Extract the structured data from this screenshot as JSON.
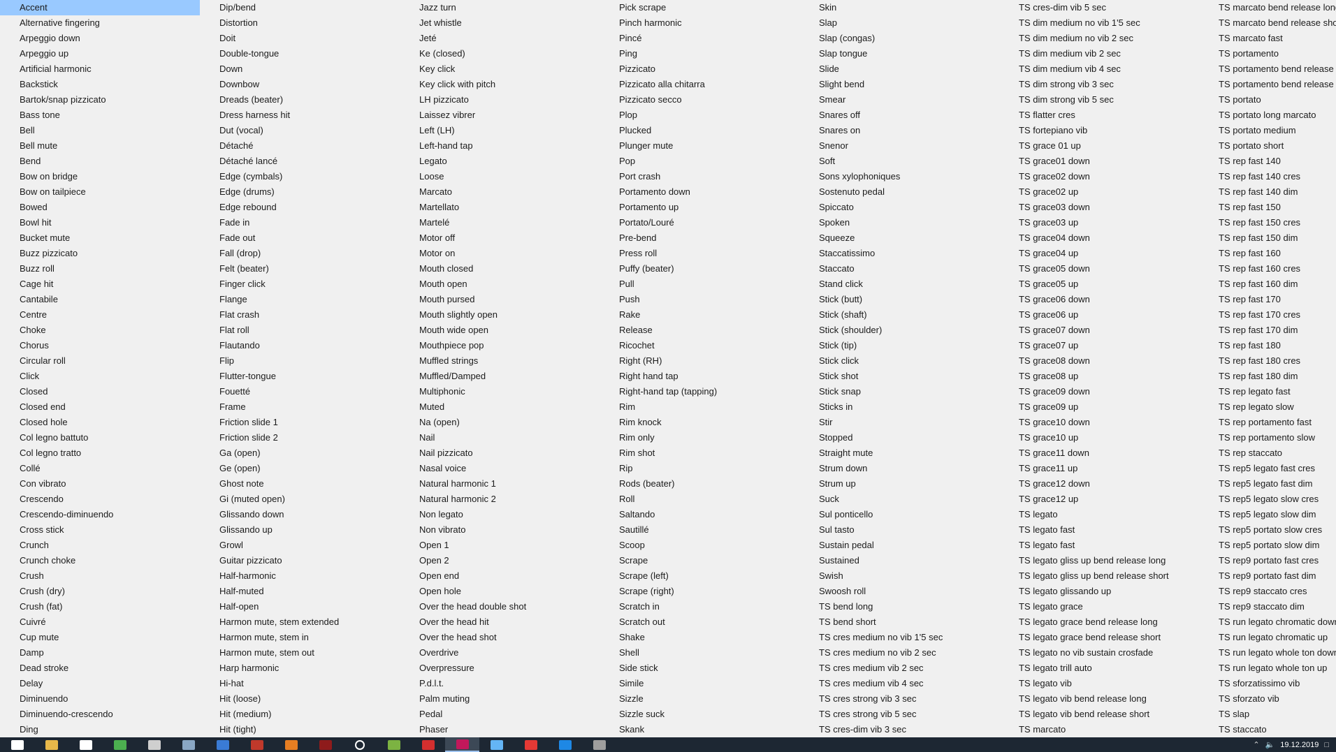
{
  "selected_item": "Accent",
  "columns": [
    [
      "Accent",
      "Alternative fingering",
      "Arpeggio down",
      "Arpeggio up",
      "Artificial harmonic",
      "Backstick",
      "Bartok/snap pizzicato",
      "Bass tone",
      "Bell",
      "Bell mute",
      "Bend",
      "Bow on bridge",
      "Bow on tailpiece",
      "Bowed",
      "Bowl hit",
      "Bucket mute",
      "Buzz pizzicato",
      "Buzz roll",
      "Cage hit",
      "Cantabile",
      "Centre",
      "Choke",
      "Chorus",
      "Circular roll",
      "Click",
      "Closed",
      "Closed end",
      "Closed hole",
      "Col legno battuto",
      "Col legno tratto",
      "Collé",
      "Con vibrato",
      "Crescendo",
      "Crescendo-diminuendo",
      "Cross stick",
      "Crunch",
      "Crunch choke",
      "Crush",
      "Crush (dry)",
      "Crush (fat)",
      "Cuivré",
      "Cup mute",
      "Damp",
      "Dead stroke",
      "Delay",
      "Diminuendo",
      "Diminuendo-crescendo",
      "Ding"
    ],
    [
      "Dip/bend",
      "Distortion",
      "Doit",
      "Double-tongue",
      "Down",
      "Downbow",
      "Dreads (beater)",
      "Dress harness hit",
      "Dut (vocal)",
      "Détaché",
      "Détaché lancé",
      "Edge (cymbals)",
      "Edge (drums)",
      "Edge rebound",
      "Fade in",
      "Fade out",
      "Fall (drop)",
      "Felt (beater)",
      "Finger click",
      "Flange",
      "Flat crash",
      "Flat roll",
      "Flautando",
      "Flip",
      "Flutter-tongue",
      "Fouetté",
      "Frame",
      "Friction slide 1",
      "Friction slide 2",
      "Ga (open)",
      "Ge (open)",
      "Ghost note",
      "Gi (muted open)",
      "Glissando down",
      "Glissando up",
      "Growl",
      "Guitar pizzicato",
      "Half-harmonic",
      "Half-muted",
      "Half-open",
      "Harmon mute, stem extended",
      "Harmon mute, stem in",
      "Harmon mute, stem out",
      "Harp harmonic",
      "Hi-hat",
      "Hit (loose)",
      "Hit (medium)",
      "Hit (tight)"
    ],
    [
      "Jazz turn",
      "Jet whistle",
      "Jeté",
      "Ke (closed)",
      "Key click",
      "Key click with pitch",
      "LH pizzicato",
      "Laissez vibrer",
      "Left (LH)",
      "Left-hand tap",
      "Legato",
      "Loose",
      "Marcato",
      "Martellato",
      "Martelé",
      "Motor off",
      "Motor on",
      "Mouth closed",
      "Mouth open",
      "Mouth pursed",
      "Mouth slightly open",
      "Mouth wide open",
      "Mouthpiece pop",
      "Muffled strings",
      "Muffled/Damped",
      "Multiphonic",
      "Muted",
      "Na (open)",
      "Nail",
      "Nail pizzicato",
      "Nasal voice",
      "Natural harmonic 1",
      "Natural harmonic 2",
      "Non legato",
      "Non vibrato",
      "Open 1",
      "Open 2",
      "Open end",
      "Open hole",
      "Over the head double shot",
      "Over the head hit",
      "Over the head shot",
      "Overdrive",
      "Overpressure",
      "P.d.l.t.",
      "Palm muting",
      "Pedal",
      "Phaser"
    ],
    [
      "Pick scrape",
      "Pinch harmonic",
      "Pincé",
      "Ping",
      "Pizzicato",
      "Pizzicato alla chitarra",
      "Pizzicato secco",
      "Plop",
      "Plucked",
      "Plunger mute",
      "Pop",
      "Port crash",
      "Portamento down",
      "Portamento up",
      "Portato/Louré",
      "Pre-bend",
      "Press roll",
      "Puffy (beater)",
      "Pull",
      "Push",
      "Rake",
      "Release",
      "Ricochet",
      "Right (RH)",
      "Right hand tap",
      "Right-hand tap (tapping)",
      "Rim",
      "Rim knock",
      "Rim only",
      "Rim shot",
      "Rip",
      "Rods (beater)",
      "Roll",
      "Saltando",
      "Sautillé",
      "Scoop",
      "Scrape",
      "Scrape (left)",
      "Scrape (right)",
      "Scratch in",
      "Scratch out",
      "Shake",
      "Shell",
      "Side stick",
      "Simile",
      "Sizzle",
      "Sizzle suck",
      "Skank"
    ],
    [
      "Skin",
      "Slap",
      "Slap (congas)",
      "Slap tongue",
      "Slide",
      "Slight bend",
      "Smear",
      "Snares off",
      "Snares on",
      "Snenor",
      "Soft",
      "Sons xylophoniques",
      "Sostenuto pedal",
      "Spiccato",
      "Spoken",
      "Squeeze",
      "Staccatissimo",
      "Staccato",
      "Stand click",
      "Stick (butt)",
      "Stick (shaft)",
      "Stick (shoulder)",
      "Stick (tip)",
      "Stick click",
      "Stick shot",
      "Stick snap",
      "Sticks in",
      "Stir",
      "Stopped",
      "Straight mute",
      "Strum down",
      "Strum up",
      "Suck",
      "Sul ponticello",
      "Sul tasto",
      "Sustain pedal",
      "Sustained",
      "Swish",
      "Swoosh roll",
      "TS bend long",
      "TS bend short",
      "TS cres medium no vib 1'5 sec",
      "TS cres medium no vib 2 sec",
      "TS cres medium vib 2 sec",
      "TS cres medium vib 4 sec",
      "TS cres strong vib 3 sec",
      "TS cres strong vib 5 sec",
      "TS cres-dim vib 3 sec"
    ],
    [
      "TS cres-dim vib 5 sec",
      "TS dim medium no vib 1'5 sec",
      "TS dim medium no vib 2 sec",
      "TS dim medium vib 2 sec",
      "TS dim medium vib 4 sec",
      "TS dim strong vib 3 sec",
      "TS dim strong vib 5 sec",
      "TS flatter cres",
      "TS fortepiano vib",
      "TS grace 01 up",
      "TS grace01 down",
      "TS grace02 down",
      "TS grace02 up",
      "TS grace03 down",
      "TS grace03 up",
      "TS grace04 down",
      "TS grace04 up",
      "TS grace05 down",
      "TS grace05 up",
      "TS grace06 down",
      "TS grace06 up",
      "TS grace07 down",
      "TS grace07 up",
      "TS grace08 down",
      "TS grace08 up",
      "TS grace09 down",
      "TS grace09 up",
      "TS grace10 down",
      "TS grace10 up",
      "TS grace11 down",
      "TS grace11 up",
      "TS grace12 down",
      "TS grace12 up",
      "TS legato",
      "TS legato fast",
      "TS legato fast",
      "TS legato gliss up bend release long",
      "TS legato gliss up bend release short",
      "TS legato glissando up",
      "TS legato grace",
      "TS legato grace bend release long",
      "TS legato grace bend release short",
      "TS legato no vib sustain crosfade",
      "TS legato trill auto",
      "TS legato vib",
      "TS legato vib bend release long",
      "TS legato vib bend release short",
      "TS marcato"
    ],
    [
      "TS marcato bend release long",
      "TS marcato bend release short",
      "TS marcato fast",
      "TS portamento",
      "TS portamento bend release",
      "TS portamento bend release",
      "TS portato",
      "TS portato long marcato",
      "TS portato medium",
      "TS portato short",
      "TS rep fast 140",
      "TS rep fast 140 cres",
      "TS rep fast 140 dim",
      "TS rep fast 150",
      "TS rep fast 150 cres",
      "TS rep fast 150 dim",
      "TS rep fast 160",
      "TS rep fast 160 cres",
      "TS rep fast 160 dim",
      "TS rep fast 170",
      "TS rep fast 170 cres",
      "TS rep fast 170 dim",
      "TS rep fast 180",
      "TS rep fast 180 cres",
      "TS rep fast 180 dim",
      "TS rep legato fast",
      "TS rep legato slow",
      "TS rep portamento fast",
      "TS rep portamento slow",
      "TS rep staccato",
      "TS rep5 legato fast cres",
      "TS rep5 legato fast dim",
      "TS rep5 legato slow cres",
      "TS rep5 legato slow dim",
      "TS rep5 portato slow cres",
      "TS rep5 portato slow dim",
      "TS rep9 portato fast cres",
      "TS rep9 portato fast dim",
      "TS rep9 staccato cres",
      "TS rep9 staccato dim",
      "TS run legato chromatic down",
      "TS run legato chromatic up",
      "TS run legato whole ton down",
      "TS run legato whole ton up",
      "TS sforzatissimo vib",
      "TS sforzato vib",
      "TS slap",
      "TS staccato"
    ]
  ],
  "taskbar": {
    "icons": [
      {
        "name": "windows-start-icon",
        "color": "#ffffff"
      },
      {
        "name": "file-explorer-icon",
        "color": "#e8b84a"
      },
      {
        "name": "mail-icon",
        "color": "#ffffff"
      },
      {
        "name": "chrome-icon",
        "color": "#4caf50"
      },
      {
        "name": "calculator-icon",
        "color": "#cfcfcf"
      },
      {
        "name": "network-icon",
        "color": "#8aa7c4"
      },
      {
        "name": "app-icon-blue",
        "color": "#3a7bd5"
      },
      {
        "name": "app-icon-red",
        "color": "#c0392b"
      },
      {
        "name": "app-icon-orange",
        "color": "#e67e22"
      },
      {
        "name": "app-icon-darkred",
        "color": "#8e1b1b"
      },
      {
        "name": "circle-app-icon",
        "color": "#ffffff"
      },
      {
        "name": "app-icon-green",
        "color": "#7cb342"
      },
      {
        "name": "app-icon-red2",
        "color": "#d32f2f"
      },
      {
        "name": "app-icon-magenta",
        "color": "#c2185b"
      },
      {
        "name": "app-icon-lightblue",
        "color": "#64b5f6"
      },
      {
        "name": "app-icon-red3",
        "color": "#e53935"
      },
      {
        "name": "app-icon-blue2",
        "color": "#1e88e5"
      },
      {
        "name": "app-icon-grey",
        "color": "#9e9e9e"
      }
    ],
    "active_index": 13,
    "clock": "19.12.2019"
  },
  "colors": {
    "background": "#f0f0f0",
    "selection": "#99c9ff",
    "taskbar": "#1d2733"
  }
}
